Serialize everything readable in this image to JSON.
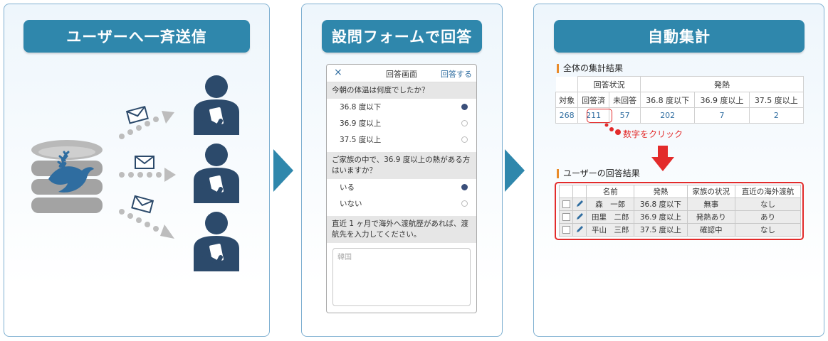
{
  "panels": {
    "send": {
      "title": "ユーザーへ一斉送信"
    },
    "answer": {
      "title": "設問フォームで回答"
    },
    "aggregate": {
      "title": "自動集計"
    }
  },
  "form": {
    "close": "×",
    "title": "回答画面",
    "submit": "回答する",
    "q1": "今朝の体温は何度でしたか？",
    "q1_options": [
      "36.8 度以下",
      "36.9 度以上",
      "37.5 度以上"
    ],
    "q2": "ご家族の中で、36.9 度以上の熱がある方はいますか？",
    "q2_options": [
      "いる",
      "いない"
    ],
    "q3": "直近 1 ヶ月で海外へ渡航歴があれば、渡航先を入力してください。",
    "q3_answer": "韓国"
  },
  "summary": {
    "title": "全体の集計結果",
    "group_status": "回答状況",
    "group_fever": "発熱",
    "headers": [
      "対象",
      "回答済",
      "未回答",
      "36.8 度以下",
      "36.9 度以上",
      "37.5 度以上"
    ],
    "values": [
      "268",
      "211",
      "57",
      "202",
      "7",
      "2"
    ],
    "click_note": "数字をクリック"
  },
  "results": {
    "title": "ユーザーの回答結果",
    "headers": [
      "名前",
      "発熱",
      "家族の状況",
      "直近の海外渡航"
    ],
    "rows": [
      [
        "森　一郎",
        "36.8 度以下",
        "無事",
        "なし"
      ],
      [
        "田里　二郎",
        "36.9 度以上",
        "発熱あり",
        "あり"
      ],
      [
        "平山　三郎",
        "37.5 度以上",
        "確認中",
        "なし"
      ]
    ]
  },
  "colors": {
    "accent": "#2f87ac",
    "highlight": "#e32b2b",
    "figure": "#2c4a6b"
  },
  "icons": [
    "database-icon",
    "dove-icon",
    "mail-icon",
    "person-icon",
    "pencil-icon",
    "down-arrow-icon"
  ]
}
